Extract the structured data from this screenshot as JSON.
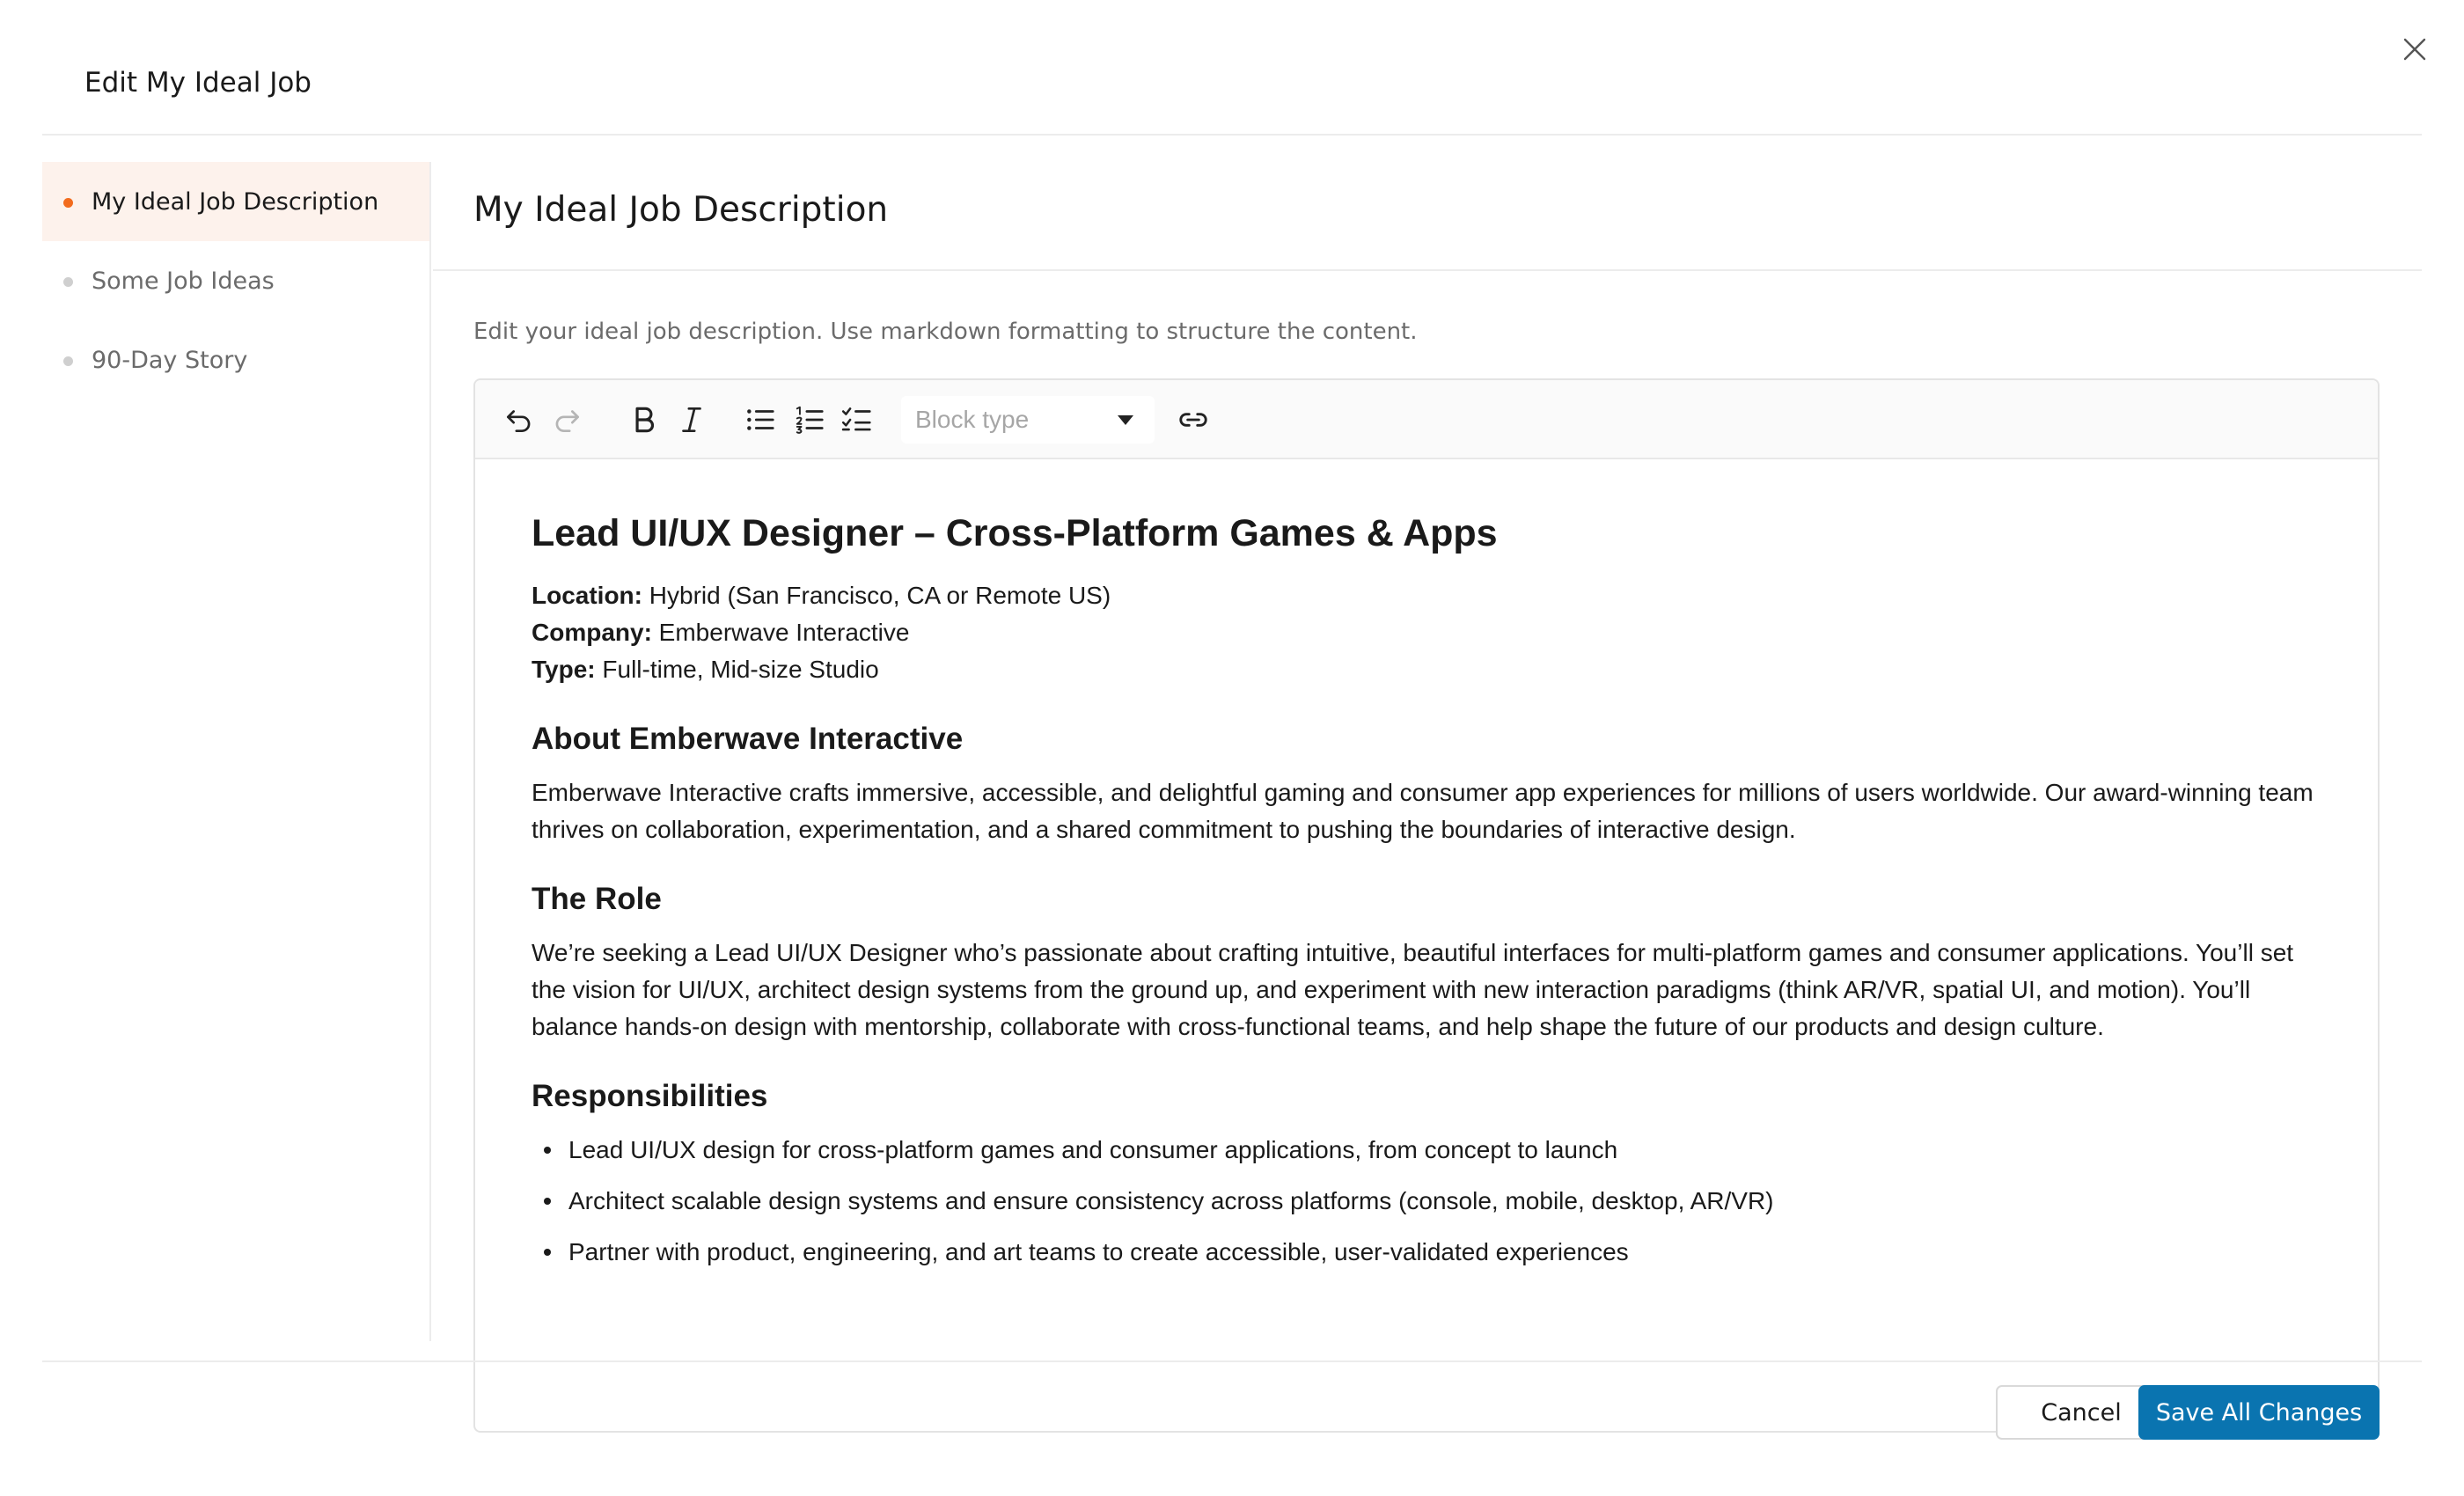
{
  "modal": {
    "title": "Edit My Ideal Job"
  },
  "sidebar": {
    "items": [
      {
        "label": "My Ideal Job Description",
        "active": true
      },
      {
        "label": "Some Job Ideas",
        "active": false
      },
      {
        "label": "90-Day Story",
        "active": false
      }
    ]
  },
  "section": {
    "title": "My Ideal Job Description",
    "description": "Edit your ideal job description. Use markdown formatting to structure the content."
  },
  "toolbar": {
    "block_type_placeholder": "Block type",
    "icons": [
      "undo-icon",
      "redo-icon",
      "bold-icon",
      "italic-icon",
      "bullet-list-icon",
      "numbered-list-icon",
      "checklist-icon",
      "link-icon"
    ]
  },
  "document": {
    "heading": "Lead UI/UX Designer – Cross-Platform Games & Apps",
    "meta": [
      {
        "label": "Location:",
        "value": " Hybrid (San Francisco, CA or Remote US)"
      },
      {
        "label": "Company:",
        "value": " Emberwave Interactive"
      },
      {
        "label": "Type:",
        "value": " Full-time, Mid-size Studio"
      }
    ],
    "about_heading": "About Emberwave Interactive",
    "about_text": "Emberwave Interactive crafts immersive, accessible, and delightful gaming and consumer app experiences for millions of users worldwide. Our award-winning team thrives on collaboration, experimentation, and a shared commitment to pushing the boundaries of interactive design.",
    "role_heading": "The Role",
    "role_text": "We’re seeking a Lead UI/UX Designer who’s passionate about crafting intuitive, beautiful interfaces for multi-platform games and consumer applications. You’ll set the vision for UI/UX, architect design systems from the ground up, and experiment with new interaction paradigms (think AR/VR, spatial UI, and motion). You’ll balance hands-on design with mentorship, collaborate with cross-functional teams, and help shape the future of our products and design culture.",
    "responsibilities_heading": "Responsibilities",
    "responsibilities": [
      "Lead UI/UX design for cross-platform games and consumer applications, from concept to launch",
      "Architect scalable design systems and ensure consistency across platforms (console, mobile, desktop, AR/VR)",
      "Partner with product, engineering, and art teams to create accessible, user-validated experiences"
    ]
  },
  "footer": {
    "cancel_label": "Cancel",
    "save_label": "Save All Changes"
  },
  "colors": {
    "accent_orange": "#f26b1d",
    "active_nav_bg": "#fdf2ec",
    "primary_blue": "#0a74b0"
  }
}
